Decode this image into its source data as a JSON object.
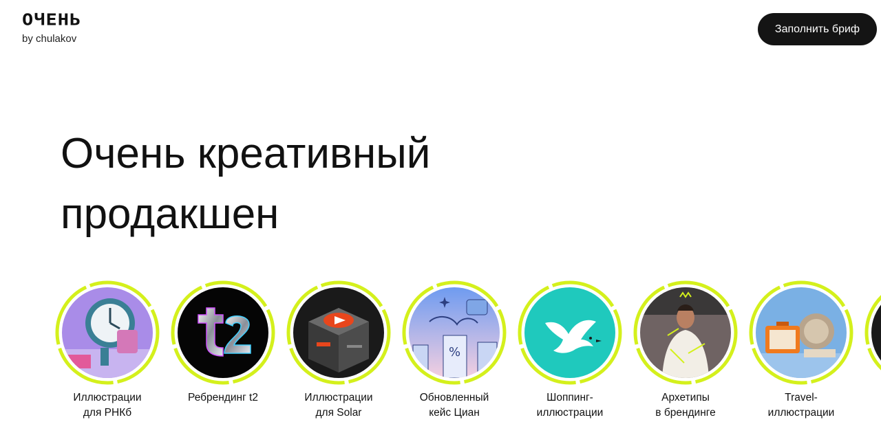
{
  "header": {
    "logo_word": "ОЧЕНЬ",
    "logo_sub": "by chulakov",
    "cta_label": "Заполнить бриф"
  },
  "hero": {
    "line1": "Очень креативный",
    "line2": "продакшен"
  },
  "colors": {
    "accent": "#d4f01c",
    "cta_bg": "#141414"
  },
  "stories": [
    {
      "line1": "Иллюстрации",
      "line2": "для РНКб",
      "icon": "clock-illustration"
    },
    {
      "line1": "Ребрендинг t2",
      "line2": "",
      "icon": "t2-logo"
    },
    {
      "line1": "Иллюстрации",
      "line2": "для Solar",
      "icon": "play-box-illustration"
    },
    {
      "line1": "Обновленный",
      "line2": "кейс Циан",
      "icon": "city-percent-illustration"
    },
    {
      "line1": "Шоппинг-",
      "line2": "иллюстрации",
      "icon": "bird-illustration"
    },
    {
      "line1": "Архетипы",
      "line2": "в брендинге",
      "icon": "person-photo"
    },
    {
      "line1": "Travel-",
      "line2": "иллюстрации",
      "icon": "suitcase-illustration"
    }
  ]
}
